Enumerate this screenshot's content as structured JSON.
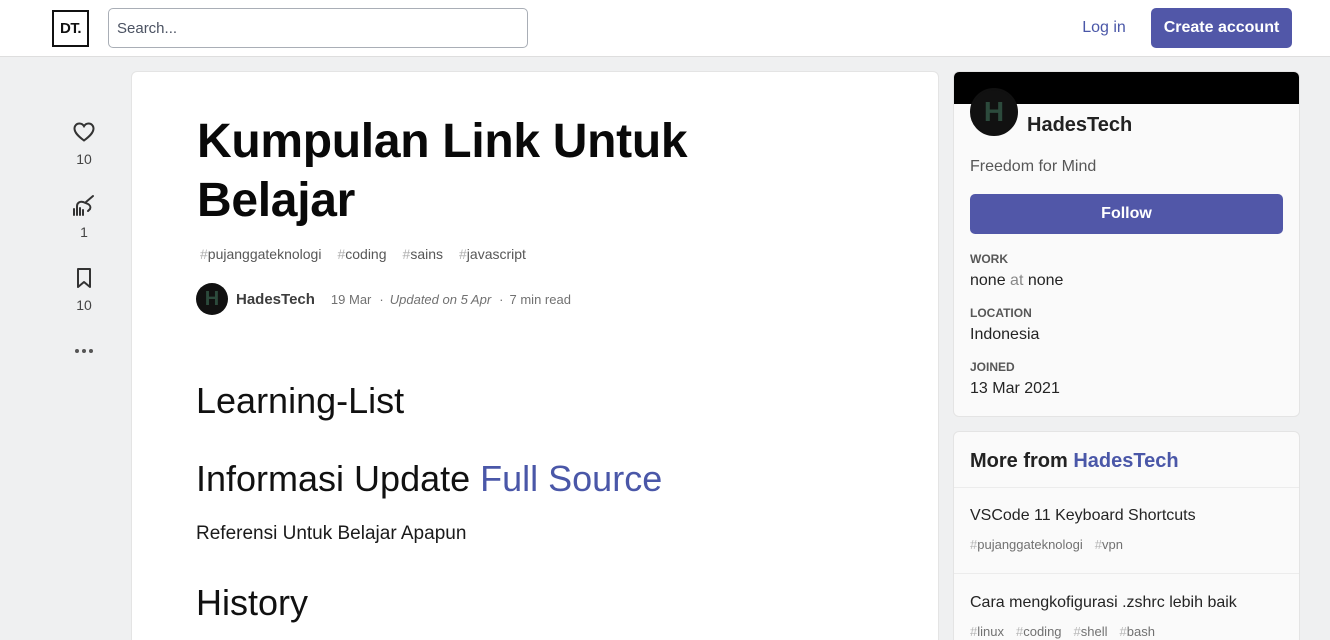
{
  "header": {
    "logo": "DT.",
    "search_placeholder": "Search...",
    "login": "Log in",
    "create_account": "Create account"
  },
  "reactions": {
    "likes": "10",
    "unicorns": "1",
    "saves": "10"
  },
  "article": {
    "title": "Kumpulan Link Untuk Belajar",
    "tags": [
      "pujanggateknologi",
      "coding",
      "sains",
      "javascript"
    ],
    "author": "HadesTech",
    "author_initial": "H",
    "date": "19 Mar",
    "updated": "Updated on 5 Apr",
    "read_time": "7 min read",
    "heading1": "Learning-List",
    "heading2_text": "Informasi Update ",
    "heading2_link": "Full Source",
    "paragraph": "Referensi Untuk Belajar Apapun",
    "heading3": "History"
  },
  "profile": {
    "name": "HadesTech",
    "initial": "H",
    "tagline": "Freedom for Mind",
    "follow": "Follow",
    "work_label": "WORK",
    "work_value_a": "none",
    "work_at": "at",
    "work_value_b": "none",
    "location_label": "LOCATION",
    "location_value": "Indonesia",
    "joined_label": "JOINED",
    "joined_value": "13 Mar 2021"
  },
  "more_from": {
    "prefix": "More from ",
    "author": "HadesTech",
    "items": [
      {
        "title": "VSCode 11 Keyboard Shortcuts",
        "tags": [
          "pujanggateknologi",
          "vpn"
        ]
      },
      {
        "title": "Cara mengkofigurasi .zshrc lebih baik",
        "tags": [
          "linux",
          "coding",
          "shell",
          "bash"
        ]
      }
    ]
  },
  "colors": {
    "accent": "#5157a8",
    "link": "#4a57a8",
    "background": "#eff0f1"
  }
}
